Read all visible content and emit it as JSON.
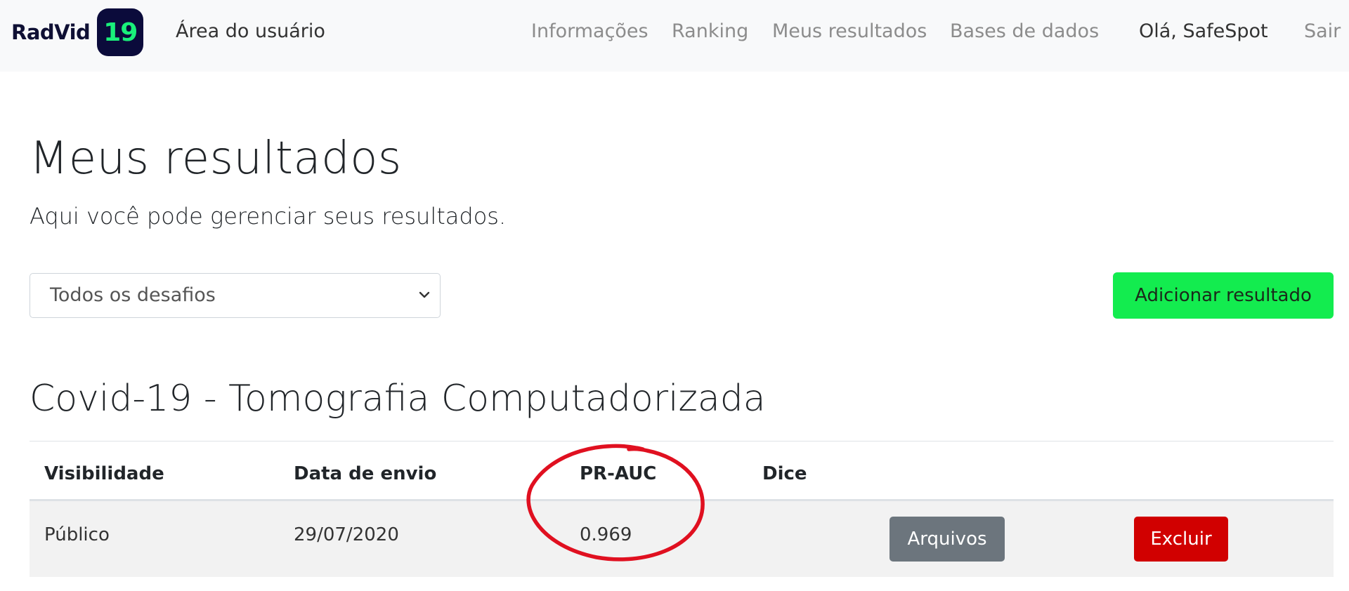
{
  "navbar": {
    "brand_name": "RadVid",
    "brand_badge": "19",
    "area_title": "Área do usuário",
    "links": [
      {
        "label": "Informações"
      },
      {
        "label": "Ranking"
      },
      {
        "label": "Meus resultados"
      },
      {
        "label": "Bases de dados"
      }
    ],
    "greeting": "Olá, SafeSpot",
    "logout_label": "Sair"
  },
  "main": {
    "title": "Meus resultados",
    "subtitle": "Aqui você pode gerenciar seus resultados.",
    "challenge_filter": {
      "selected": "Todos os desafios"
    },
    "add_button_label": "Adicionar resultado",
    "section_title": "Covid-19 - Tomografia Computadorizada",
    "table": {
      "headers": [
        "Visibilidade",
        "Data de envio",
        "PR-AUC",
        "Dice"
      ],
      "rows": [
        {
          "visibility": "Público",
          "date": "29/07/2020",
          "pr_auc": "0.969",
          "dice": "",
          "files_label": "Arquivos",
          "delete_label": "Excluir"
        }
      ]
    }
  },
  "colors": {
    "navbar_bg": "#f8f9fa",
    "badge_bg": "#0b0b3b",
    "badge_text": "#19f07a",
    "add_button": "#13ec4f",
    "files_button": "#6c757d",
    "delete_button": "#d10000",
    "annotation_circle": "#e01020"
  },
  "icons": {
    "select_chevron": "chevron-down-icon"
  }
}
